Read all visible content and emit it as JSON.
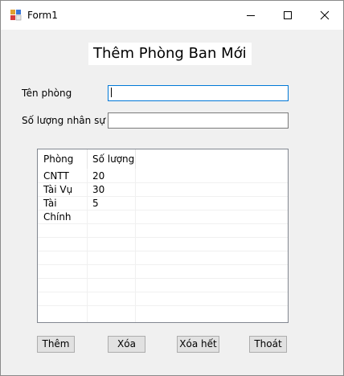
{
  "window": {
    "title": "Form1"
  },
  "heading": "Thêm Phòng Ban Mới",
  "form": {
    "name_label": "Tên phòng",
    "name_value": "",
    "count_label": "Số lượng nhân sự",
    "count_value": ""
  },
  "list": {
    "columns": [
      "Phòng",
      "Số lượng"
    ],
    "rows": [
      [
        "CNTT",
        "20"
      ],
      [
        "Tài Vụ",
        "30"
      ],
      [
        "Tài Chính",
        "5"
      ]
    ]
  },
  "buttons": {
    "add": "Thêm",
    "delete": "Xóa",
    "delete_all": "Xóa hết",
    "exit": "Thoát"
  },
  "colors": {
    "accent_focus": "#0078d7",
    "form_background": "#f0f0f0"
  }
}
